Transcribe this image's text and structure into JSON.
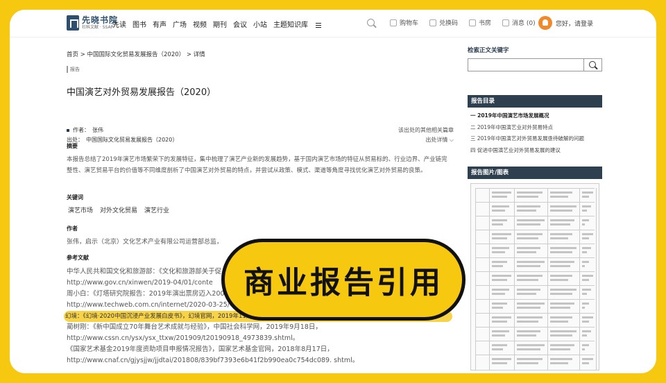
{
  "header": {
    "logo_name": "先晓书院",
    "logo_sub": "社科文献 · SSAP",
    "nav": [
      "先读",
      "图书",
      "有声",
      "广场",
      "视频",
      "期刊",
      "会议",
      "小站",
      "主题知识库"
    ],
    "tools": [
      "购物车",
      "兑换码",
      "书房",
      "消息 (0)"
    ],
    "greeting": "您好，请登录"
  },
  "breadcrumb": "首页 > 中国国际文化贸易发展报告（2020） > 详情",
  "tag": "报告",
  "page_title": "中国演艺对外贸易发展报告（2020）",
  "meta": {
    "author": "作者：　张伟",
    "source": "出处：　中国国际文化贸易发展报告（2020）",
    "related_link": "该出处的其他相关篇章",
    "source_detail": "出处详情"
  },
  "abstract": {
    "label": "摘要",
    "text": "本报告总结了2019年演艺市场繁荣下的发展特征，集中梳理了演艺产业新的发展趋势，基于国内演艺市场的特征从贸易标的、行业边界、产业链完整性、演艺贸易平台的价值等不同维度剖析了中国演艺对外贸易的特点，并尝试从政策、模式、渠道等角度寻找优化演艺对外贸易的良策。"
  },
  "keywords": {
    "label": "关键词",
    "items": [
      "演艺市场",
      "对外文化贸易",
      "演艺行业"
    ]
  },
  "author_section": {
    "label": "作者",
    "text": "张伟，启示（北京）文化艺术产业有限公司运营部总监，"
  },
  "references": {
    "label": "参考文献",
    "items": [
      "中华人民共和国文化和旅游部：《文化和旅游部关于促",
      "http://www.gov.cn/xinwen/2019-04/01/conte",
      "周小白：《灯塔研究院报告：2019年演出票房迈入200",
      "http://www.techweb.com.cn/internet/2020-03-25/",
      "幻境：《幻境·2020中国沉浸产业发展白皮书》，幻境官网，2019年11月22日，http://illuthion.com/talks/ciid2020whitepaper/。",
      "蔺树刚：《新中国成立70年舞台艺术成就与经验》，中国社会科学网，2019年9月18日，",
      "http://www.cssn.cn/ysx/ysx_ttxw/201909/t20190918_4973839.shtml。",
      "《国家艺术基金2019年度资助项目申报情况报告》，国家艺术基金官网，2018年8月17日，",
      "http://www.cnaf.cn/gjysjjw/jjdtai/201808/839bf7393e6b41f2b990ea0c754dc089. shtml。"
    ]
  },
  "sidebar": {
    "search_label": "检索正文关键字",
    "search_placeholder": "",
    "toc_title": "报告目录",
    "toc": [
      "一 2019年中国演艺市场发展概况",
      "二 2019年中国演艺业对外贸易特点",
      "三 2019年中国演艺对外贸易发展亟待破解的问题",
      "四 促进中国演艺业对外贸易发展的建议"
    ],
    "figures_title": "报告图片/图表"
  },
  "banner": "商业报告引用",
  "colors": {
    "accent_yellow": "#f7c810",
    "dark_navy": "#2e3f50"
  }
}
